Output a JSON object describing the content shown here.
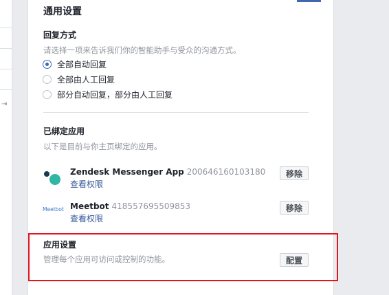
{
  "section": {
    "title": "通用设置"
  },
  "reply_mode": {
    "title": "回复方式",
    "description": "请选择一项来告诉我们你的智能助手与受众的沟通方式。",
    "options": [
      {
        "label": "全部自动回复",
        "selected": true
      },
      {
        "label": "全部由人工回复",
        "selected": false
      },
      {
        "label": "部分自动回复，部分由人工回复",
        "selected": false
      }
    ]
  },
  "bound_apps": {
    "title": "已绑定应用",
    "description": "以下是目前与你主页绑定的应用。",
    "apps": [
      {
        "name": "Zendesk Messenger App",
        "id": "200646160103180",
        "link": "查看权限",
        "button": "移除"
      },
      {
        "name": "Meetbot",
        "logo_text": "Meetbot",
        "id": "418557695509853",
        "link": "查看权限",
        "button": "移除"
      }
    ]
  },
  "app_settings": {
    "title": "应用设置",
    "description": "管理每个应用可访问或控制的功能。",
    "button": "配置"
  },
  "colors": {
    "accent": "#4267b2",
    "link": "#365899",
    "highlight": "#e4151f"
  }
}
